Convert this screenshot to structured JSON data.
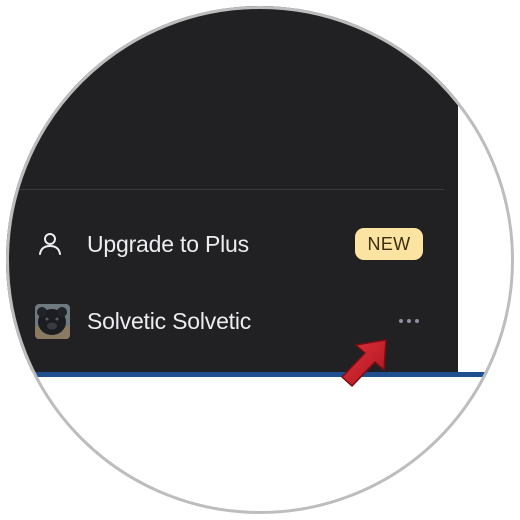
{
  "menu": {
    "upgrade": {
      "label": "Upgrade to Plus",
      "badge": "NEW",
      "icon": "person-icon"
    },
    "user": {
      "name": "Solvetic Solvetic",
      "avatar": "avatar-image",
      "more_icon": "ellipsis-icon"
    }
  },
  "annotation": {
    "arrow_color": "#d0242f"
  },
  "colors": {
    "sidebar_bg": "#212123",
    "badge_bg": "#fbe3a1",
    "text": "#ececf1",
    "accent_bar": "#1f4f8f"
  }
}
